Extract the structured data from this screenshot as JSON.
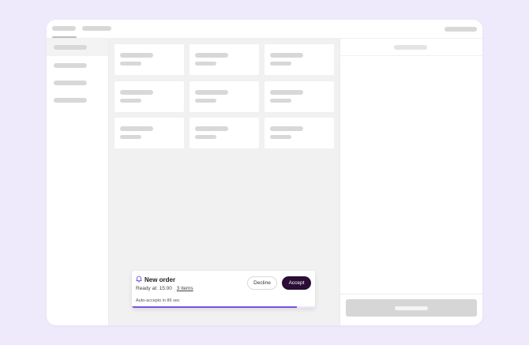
{
  "toast": {
    "title": "New order",
    "ready_at": "Ready at: 15:00",
    "items_link": "3 items",
    "auto_accept": "Auto-accepts in 86 sec",
    "decline_label": "Decline",
    "accept_label": "Accept",
    "progress_fraction": 0.9
  },
  "colors": {
    "page_background": "#eeeafc",
    "accept_button": "#2a0e35",
    "progress": "#7b4fe0",
    "placeholder": "#d8d8d8"
  },
  "icons": {
    "toast_icon": "bell-icon"
  }
}
